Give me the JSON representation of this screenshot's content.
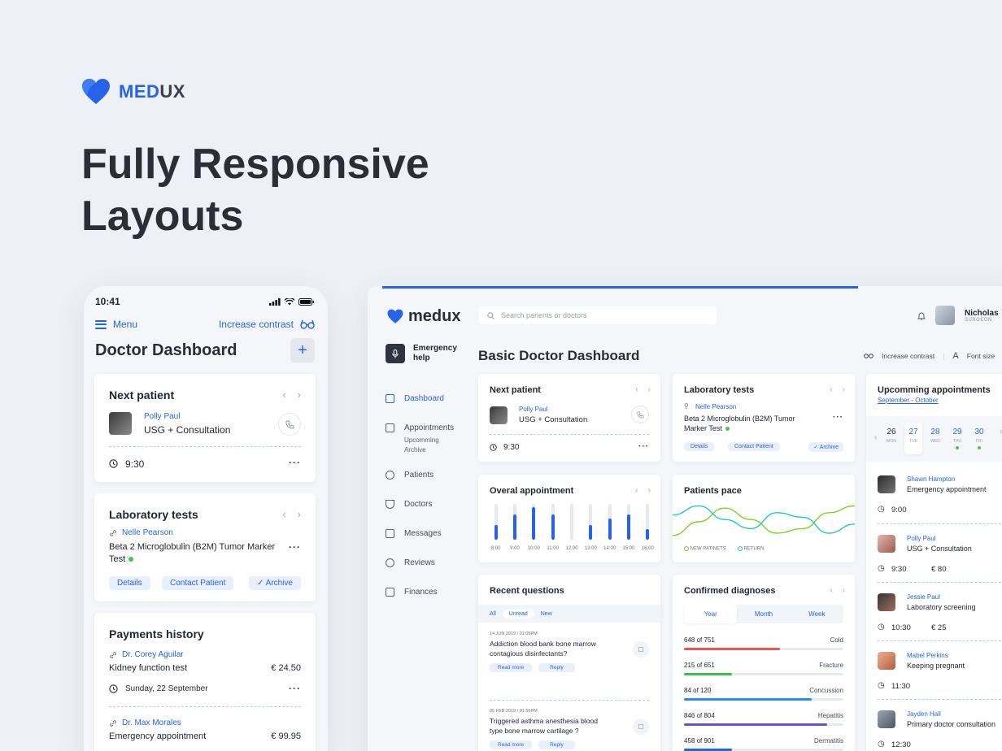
{
  "brand": {
    "me": "MED",
    "ux": "UX"
  },
  "hero": {
    "line1": "Fully Responsive",
    "line2": "Layouts"
  },
  "mobile": {
    "time": "10:41",
    "menu_label": "Menu",
    "contrast_label": "Increase contrast",
    "title": "Doctor Dashboard",
    "plus": "+",
    "next_patient": {
      "title": "Next patient",
      "name": "Polly Paul",
      "procedure": "USG + Consultation",
      "time": "9:30"
    },
    "lab_tests": {
      "title": "Laboratory tests",
      "name": "Nelle Pearson",
      "test": "Beta 2 Microglobulin (B2M) Tumor Marker Test",
      "details": "Details",
      "contact": "Contact Patient",
      "archive": "✓ Archive"
    },
    "payments": {
      "title": "Payments history",
      "items": [
        {
          "doctor": "Dr. Corey Aguilar",
          "service": "Kidney function test",
          "amount": "€  24.50",
          "date": "Sunday, 22 September"
        },
        {
          "doctor": "Dr. Max Morales",
          "service": "Emergency appointment",
          "amount": "€  99.95"
        }
      ]
    }
  },
  "desktop": {
    "logo": "medux",
    "search_placeholder": "Search parients or doctors",
    "user": {
      "name": "Nicholas",
      "role": "SURGEON"
    },
    "emergency": {
      "line1": "Emergency",
      "line2": "help"
    },
    "nav": [
      {
        "label": "Dashboard"
      },
      {
        "label": "Appointments"
      },
      {
        "label": "Patients"
      },
      {
        "label": "Doctors"
      },
      {
        "label": "Messages"
      },
      {
        "label": "Reviews"
      },
      {
        "label": "Finances"
      }
    ],
    "nav_sub": {
      "a": "Upcomming",
      "b": "Archive"
    },
    "title": "Basic Doctor Dashboard",
    "tools": {
      "contrast": "Increase contrast",
      "font": "Font size"
    },
    "next_patient": {
      "title": "Next patient",
      "name": "Polly Paul",
      "procedure": "USG + Consultation",
      "time": "9:30"
    },
    "lab_tests": {
      "title": "Laboratory tests",
      "name": "Nelle Pearson",
      "test_line1": "Beta 2 Microglobulin (B2M) Tumor",
      "test_line2": "Marker Test",
      "details": "Details",
      "contact": "Contact Patient",
      "archive": "✓ Archive"
    },
    "overall": {
      "title": "Overal appointment"
    },
    "pace": {
      "title": "Patients pace",
      "legend_new": "NEW PATINETS",
      "legend_return": "RETURN"
    },
    "questions": {
      "title": "Recent questions",
      "tabs": [
        "All",
        "Unread",
        "New"
      ],
      "items": [
        {
          "date": "14 JUN 2019",
          "time": "01:05PM",
          "line1": "Addiction blood bank bone marrow",
          "line2": "contagious disinfectants?",
          "more": "Read more",
          "reply": "Reply"
        },
        {
          "date": "05 FEB 2019",
          "time": "01:56PM",
          "line1": "Triggered asthma anesthesia blood",
          "line2": "type bone marrow cartilage ?",
          "more": "Read more",
          "reply": "Reply"
        }
      ]
    },
    "diagnoses": {
      "title": "Confirmed diagnoses",
      "tabs": [
        "Year",
        "Month",
        "Week"
      ],
      "items": [
        {
          "label": "648 of 751",
          "name": "Cold"
        },
        {
          "label": "215 of 651",
          "name": "Fracture"
        },
        {
          "label": "84 of 120",
          "name": "Concussion"
        },
        {
          "label": "846 of 804",
          "name": "Hepatitis"
        },
        {
          "label": "458 of 901",
          "name": "Dermatitis"
        }
      ]
    },
    "upcoming": {
      "title": "Upcomming appointments",
      "range": "September - October",
      "days": [
        {
          "n": "26",
          "w": "MON"
        },
        {
          "n": "27",
          "w": "TUE"
        },
        {
          "n": "28",
          "w": "WED"
        },
        {
          "n": "29",
          "w": "THU"
        },
        {
          "n": "30",
          "w": "FRI"
        },
        {
          "n": "",
          "w": "S"
        }
      ],
      "items": [
        {
          "name": "Shawn Hampton",
          "what": "Emergency appointment",
          "time": "9:00"
        },
        {
          "name": "Polly Paul",
          "what": "USG + Consultation",
          "time": "9:30",
          "price": "€  80"
        },
        {
          "name": "Jessie Paul",
          "what": "Laboratory screening",
          "time": "10:30",
          "price": "€  25"
        },
        {
          "name": "Mabel Perkins",
          "what": "Keeping pregnant",
          "time": "11:30"
        },
        {
          "name": "Jayden Hall",
          "what": "Primary doctor consultation",
          "time": "12:30"
        }
      ]
    }
  },
  "chart_data": [
    {
      "type": "bar",
      "title": "Overal appointment",
      "categories": [
        "8:00",
        "9:00",
        "10:00",
        "11:00",
        "12:00",
        "13:00",
        "14:00",
        "15:00",
        "16:00"
      ],
      "values": [
        0.4,
        0.7,
        0.9,
        0.7,
        0.0,
        0.4,
        0.6,
        0.7,
        0.3
      ]
    },
    {
      "type": "line",
      "title": "Patients pace",
      "series": [
        {
          "name": "NEW PATINETS",
          "values": [
            0.2,
            0.5,
            0.8,
            0.55,
            0.25,
            0.35,
            0.7,
            0.85
          ]
        },
        {
          "name": "RETURN",
          "values": [
            0.65,
            0.85,
            0.55,
            0.35,
            0.7,
            0.6,
            0.25,
            0.45
          ]
        }
      ]
    },
    {
      "type": "bar",
      "title": "Confirmed diagnoses",
      "categories": [
        "Cold",
        "Fracture",
        "Concussion",
        "Hepatitis",
        "Dermatitis"
      ],
      "values": [
        0.6,
        0.3,
        0.8,
        0.9,
        0.3
      ],
      "colors": [
        "#f0524e",
        "#37c24a",
        "#2a8ee6",
        "#6a4fd6",
        "#2563eb"
      ]
    }
  ]
}
